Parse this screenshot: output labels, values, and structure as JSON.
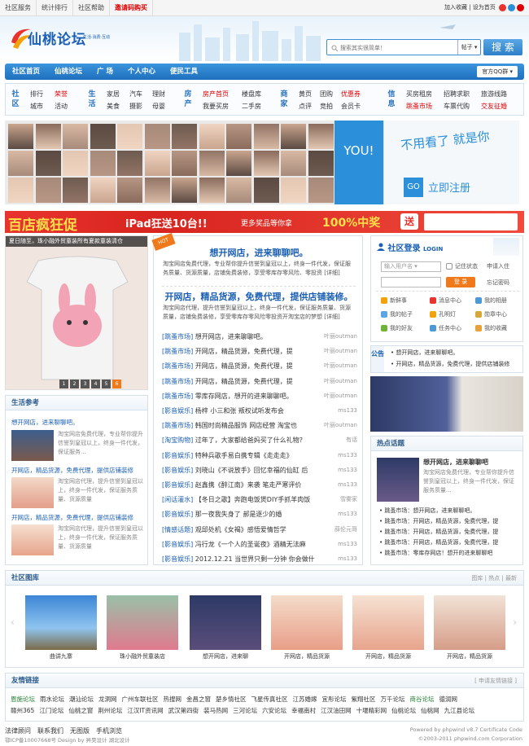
{
  "topbar": {
    "items": [
      "社区服务",
      "统计排行",
      "社区帮助",
      "邀请码购买"
    ],
    "right": "加入收藏 | 设为首页"
  },
  "header": {
    "logo": "仙桃论坛",
    "logo_sub": "生活·消费·互动",
    "search_placeholder": "搜索其实很简单！",
    "search_type": "帖子",
    "search_btn": "搜 索"
  },
  "nav": {
    "items": [
      "社区首页",
      "仙桃论坛",
      "广 场",
      "个人中心",
      "便民工具"
    ],
    "right": "官方QQ群"
  },
  "cats": [
    {
      "title": "社区",
      "items": [
        "排行",
        "荣誉",
        "城市",
        "活动"
      ]
    },
    {
      "title": "生活",
      "items": [
        "家居",
        "汽车",
        "理财",
        "美食",
        "摄影",
        "母婴"
      ]
    },
    {
      "title": "房产",
      "items": [
        "房产首页",
        "楼盘库",
        "我要买房",
        "二手房"
      ]
    },
    {
      "title": "商家",
      "items": [
        "黄页",
        "团购",
        "优惠券",
        "点评",
        "竞拍",
        "会员卡"
      ]
    },
    {
      "title": "信息",
      "items": [
        "买房租房",
        "招聘求职",
        "旅游线路",
        "跳蚤市场",
        "车票代购",
        "交友征婚"
      ]
    }
  ],
  "banner": {
    "you": "YOU!",
    "ad_text": "不用看了 就是你",
    "go": "GO",
    "join": "立即注册"
  },
  "promo": {
    "t1": "百店疯狂促",
    "t2": "iPad狂送10台!!",
    "t3": "更多奖品等你拿",
    "t4": "100%中奖",
    "t5": "送"
  },
  "photo": {
    "caption": "夏日随至，珠小融外贸童装所有夏款童装清仓",
    "pages": [
      "1",
      "2",
      "3",
      "4",
      "5",
      "6"
    ]
  },
  "mid": {
    "t1": "想开网店，进来聊聊吧。",
    "p1": "淘宝网店免费代理，专业帮你提升信誉到皇冠以上，终身一件代发，保证服务质量、货源质量，店铺免费装修，享受零库存零风险、零投资 [详细]",
    "t2": "开网店，精品货源，免费代理，提供店铺装修。",
    "p2": "淘宝网店代理，提升信誉到皇冠以上，终身一件代发，保证服务质量、货源质量，店铺免费装修，享受零库存零风险零投资开淘宝店的梦想 [详细]",
    "rows": [
      {
        "c": "[跳蚤市场]",
        "t": "想开网店，进来聊聊吧。",
        "a": "叶丽outman"
      },
      {
        "c": "[跳蚤市场]",
        "t": "开网店，精品货源，免费代理，提",
        "a": "叶丽outman"
      },
      {
        "c": "[跳蚤市场]",
        "t": "开网店，精品货源，免费代理，提",
        "a": "叶丽outman"
      },
      {
        "c": "[跳蚤市场]",
        "t": "开网店，精品货源，免费代理，提",
        "a": "叶丽outman"
      },
      {
        "c": "[跳蚤市场]",
        "t": "零库存网店，想开的进来聊聊吧。",
        "a": "叶丽outman"
      },
      {
        "c": "[影音娱乐]",
        "t": "杨梓 小三和张 叛权试听发布会",
        "a": "ms133"
      },
      {
        "c": "[跳蚤市场]",
        "t": "韩国时尚精品服饰 网店经营 淘宝也",
        "a": "叶丽outman"
      },
      {
        "c": "[淘宝购物]",
        "t": "过年了，大家都给爸妈买了什么礼物?",
        "a": "有话"
      },
      {
        "c": "[影音娱乐]",
        "t": "特种兵歌手易白携专辑《走走走》",
        "a": "ms133"
      },
      {
        "c": "[影音娱乐]",
        "t": "刘晓山《不说放手》回忆幸福的仙缸 后",
        "a": "ms133"
      },
      {
        "c": "[影音娱乐]",
        "t": "赵鑫携《醉江南》来袭 笔走严寒评价",
        "a": "ms133"
      },
      {
        "c": "[闲话灌水]",
        "t": "【冬日之歌】奔跑电饭煲DIY手抓羊肉饭",
        "a": "雪雾家"
      },
      {
        "c": "[影音娱乐]",
        "t": "那一夜我失身了 郝是逐少的婚",
        "a": "ms133"
      },
      {
        "c": "[情感话题]",
        "t": "观邱处机《女褐》感悟爱情哲学",
        "a": "薛伦元哥"
      },
      {
        "c": "[影音娱乐]",
        "t": "冯行龙《一个人的圣诞夜》酒精无法麻",
        "a": "ms133"
      },
      {
        "c": "[影音娱乐]",
        "t": "2012.12.21 当世界只剩一分钟 你会做什",
        "a": "ms133"
      }
    ]
  },
  "login": {
    "title": "社区登录",
    "title_en": "LOGIN",
    "user_ph": "输入用户名",
    "remember": "记住状态",
    "apply": "申请入住",
    "btn": "登 录",
    "forgot": "忘记密码",
    "quick": [
      "新鲜事",
      "消息中心",
      "我的相册",
      "我的帖子",
      "孔明灯",
      "勋章中心",
      "我的好友",
      "任务中心",
      "我的收藏"
    ]
  },
  "notice": {
    "label": "公告",
    "items": [
      "想开网店，进来聊聊吧。",
      "开网店，精品货源，免费代理，提供店铺装修"
    ]
  },
  "shq": {
    "title": "生活参考",
    "top": "想开网店，进来聊聊吧。",
    "items": [
      {
        "t": "想开网店，进来聊聊吧。",
        "d": "淘宝网店免费代理，专业帮你提升信誉到皇冠以上，终身一件代发，保证服务..."
      },
      {
        "t": "开网店，精品货源，免费代理，提供店铺装修",
        "d": "淘宝网店代理，提升信誉到皇冠以上，终身一件代发，保证服务质量、货源质量"
      },
      {
        "t": "开网店，精品货源，免费代理，提供店铺装修",
        "d": "淘宝网店代理，提升信誉到皇冠以上，终身一件代发，保证服务质量、货源质量"
      }
    ]
  },
  "hot": {
    "title": "热点话题",
    "head": "想开网店，进来聊聊吧",
    "desc": "淘宝网店免费代理，专业帮你提升信誉到皇冠以上，终身一件代发，保证服务质量...",
    "items": [
      "跳蚤市场：想开网店，进来聊聊吧。",
      "跳蚤市场：开网店，精品货源，免费代理，提",
      "跳蚤市场：开网店，精品货源，免费代理，提",
      "跳蚤市场：开网店，精品货源，免费代理，提",
      "跳蚤市场：零库存网店！想开的进来聊聊吧"
    ]
  },
  "gallery": {
    "title": "社区图库",
    "tabs": [
      "图库",
      "热点",
      "最新"
    ],
    "captions": [
      "曲讲九寨",
      "珠小融外贸童装店",
      "想开网店，进来聊",
      "开网店，精品货源",
      "开网店，精品货源",
      "开网店，精品货源"
    ]
  },
  "links": {
    "title": "友情链接",
    "apply": "[ 申请友情链接 ]",
    "row1": [
      "恩施论坛",
      "雨水论坛",
      "潮汕论坛",
      "龙洞网",
      "广州车联社区",
      "热搜网",
      "金昌之窗",
      "楚乡情社区",
      "飞星传真社区",
      "江苏婚嫁",
      "宜彤论坛",
      "紫翔社区",
      "万千论坛",
      "商谷论坛",
      "德润网"
    ],
    "row2": [
      "赣州365",
      "江门论坛",
      "仙桃之窗",
      "荆州论坛",
      "江汉IT资讯网",
      "武汉第四街",
      "装马热网",
      "三河论坛",
      "六安论坛",
      "幸福南村",
      "江汉油田网",
      "十堰精彩网",
      "仙桃论坛",
      "仙桃网",
      "九江县论坛"
    ]
  },
  "footer": {
    "nav": [
      "法律顾问",
      "联系我们",
      "无图版",
      "手机浏览"
    ],
    "icp": "鄂ICP备10007668号 Design by 昇昊设计 湖北设计",
    "right1": "Powered by phpwind v8.7 Certificate Code",
    "right2": "©2003-2011 phpwind.com Corporation"
  },
  "colors": {
    "accent": "#1e6fbd",
    "promo": "#e8332e",
    "login_btn": "#f07a1b"
  }
}
